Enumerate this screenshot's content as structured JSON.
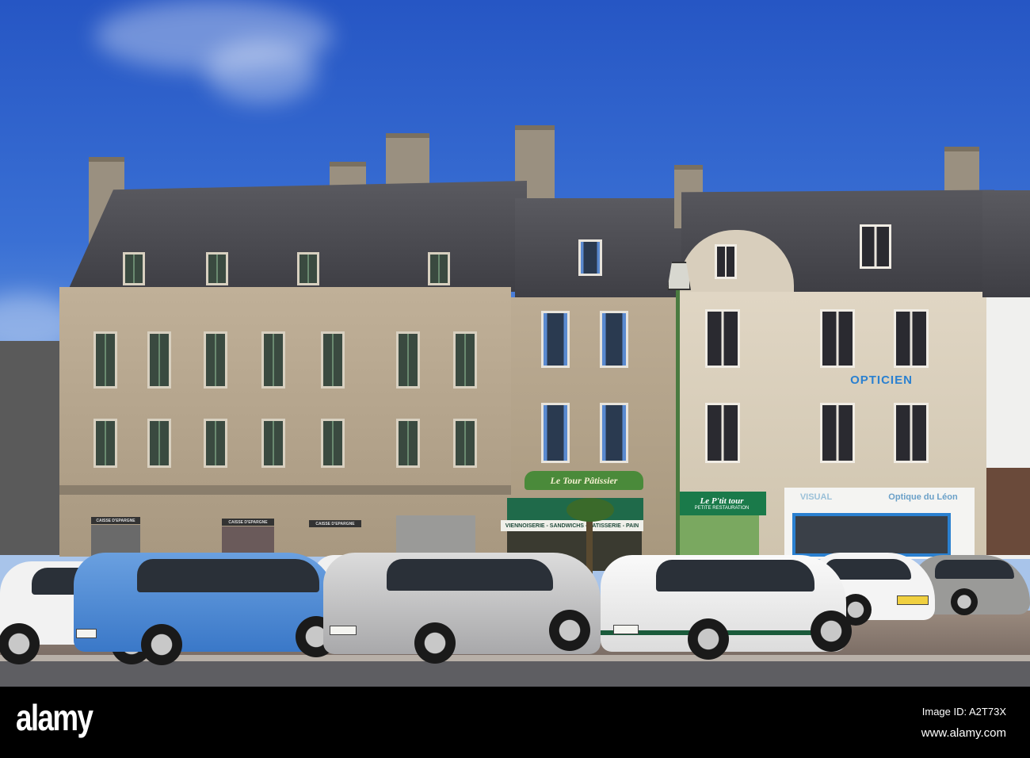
{
  "photo": {
    "signs": {
      "opticien": "OPTICIEN",
      "patisserie_name": "Le Tour Pâtissier",
      "patisserie_awning": "VIENNOISERIE - SANDWICHS - PATISSERIE - PAIN",
      "restaurant_name": "Le P'tit tour",
      "restaurant_sub": "PETITE RESTAURATION",
      "optician_left": "VISUAL",
      "optician_right": "Optique du Léon",
      "bank_1": "CAISSE D'EPARGNE",
      "bank_2": "CAISSE D'EPARGNE",
      "bank_3": "CAISSE D'EPARGNE"
    },
    "colors": {
      "sky": "#3a70d4",
      "awning": "#1f6a4a",
      "sign_green": "#4a8a3a",
      "optician_blue": "#2a80d0"
    }
  },
  "watermark": {
    "logo": "alamy",
    "image_id": "Image ID: A2T73X",
    "url": "www.alamy.com"
  }
}
